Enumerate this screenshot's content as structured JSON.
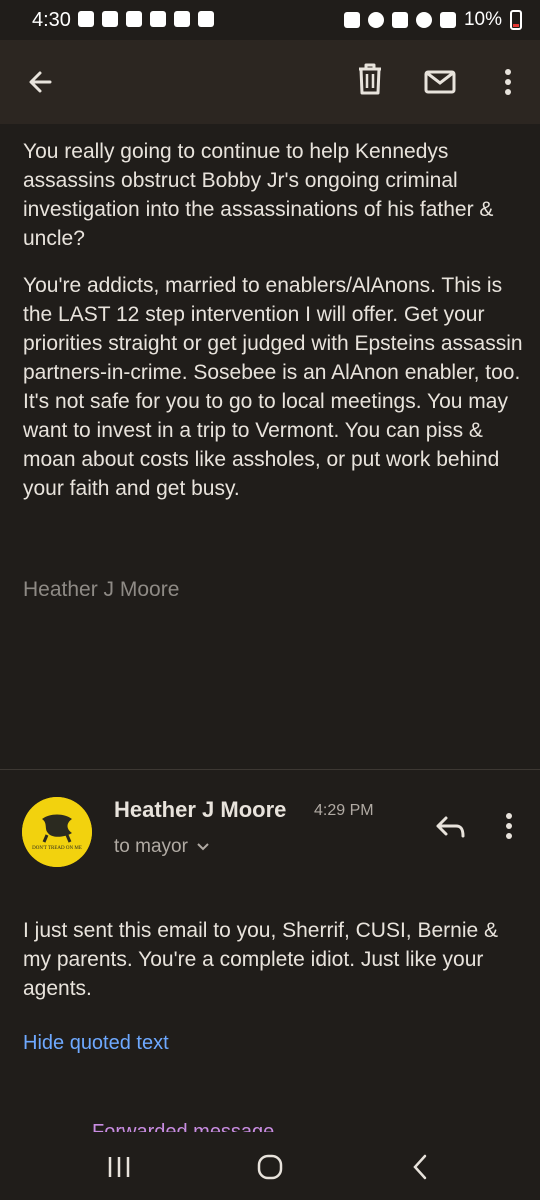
{
  "status_bar": {
    "time": "4:30",
    "battery": "10%",
    "battery_color": "#e53935"
  },
  "toolbar": {
    "back_icon": "arrow-left-icon",
    "delete_icon": "trash-icon",
    "mark_unread_icon": "mail-icon",
    "more_icon": "more-vertical-icon"
  },
  "quoted_message": {
    "paragraph1": "You really going to continue to help Kennedys assassins obstruct Bobby Jr's ongoing criminal investigation into the assassinations of his father & uncle?",
    "paragraph2": "You're addicts, married to enablers/AlAnons. This is the LAST 12 step intervention I will offer. Get your priorities straight or get judged with Epsteins assassin partners-in-crime. Sosebee is an AlAnon enabler, too. It's not safe for you to go to local meetings. You may want to invest in a trip to Vermont. You can piss & moan about costs like assholes, or put work behind your faith and get busy.",
    "signature": "Heather J Moore"
  },
  "message": {
    "sender": "Heather J Moore",
    "time": "4:29 PM",
    "to": "to mayor",
    "avatar_text": "DON'T TREAD ON ME",
    "avatar_color": "#f2d20e",
    "body": "I just sent this email to you, Sherrif, CUSI, Bernie & my parents. You're a complete idiot. Just like your agents.",
    "hide_quoted_label": "Hide quoted text",
    "forwarded_label": "Forwarded message"
  },
  "colors": {
    "background": "#201d1a",
    "appbar": "#2c2621",
    "link": "#6ea9ff",
    "forwarded": "#c98de2"
  }
}
